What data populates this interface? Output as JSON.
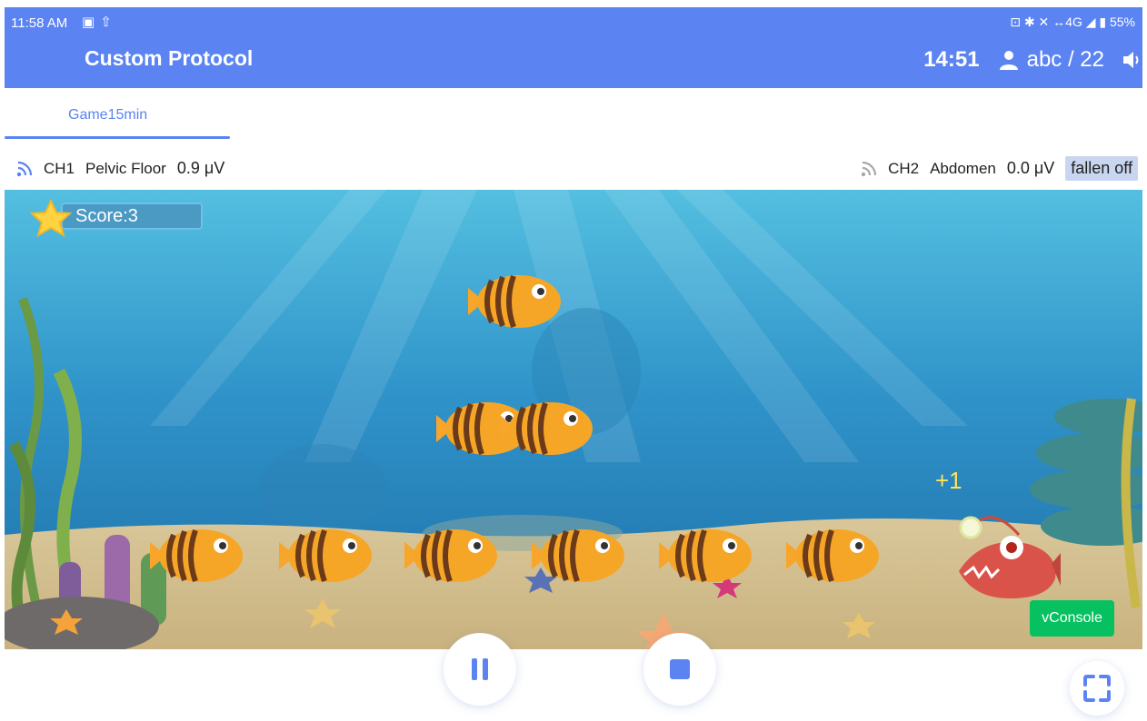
{
  "status_bar": {
    "time": "11:58 AM",
    "left_icons": [
      "image-icon",
      "upload-icon"
    ],
    "right_text": "⊡ ✱ ✕ ↔4G ◢ ▮ 55%",
    "battery_percent": 55
  },
  "header": {
    "title": "Custom Protocol",
    "timer": "14:51",
    "user_label": "abc / 22"
  },
  "tabs": [
    {
      "label": "Game15min",
      "active": true
    }
  ],
  "channels": {
    "ch1": {
      "label": "CH1",
      "name": "Pelvic Floor",
      "value": "0.9 μV"
    },
    "ch2": {
      "label": "CH2",
      "name": "Abdomen",
      "value": "0.0 μV",
      "status": "fallen off"
    }
  },
  "game": {
    "score_text": "Score:3",
    "bonus_text": "+1",
    "fish_count": 9
  },
  "vconsole_label": "vConsole",
  "controls": {
    "pause": "pause-icon",
    "stop": "stop-icon",
    "fullscreen": "fullscreen-icon"
  },
  "colors": {
    "header_bg": "#5b84f2",
    "accent": "#5b84f2",
    "vconsole_bg": "#07c160",
    "badge_bg": "#c8d6ef"
  }
}
